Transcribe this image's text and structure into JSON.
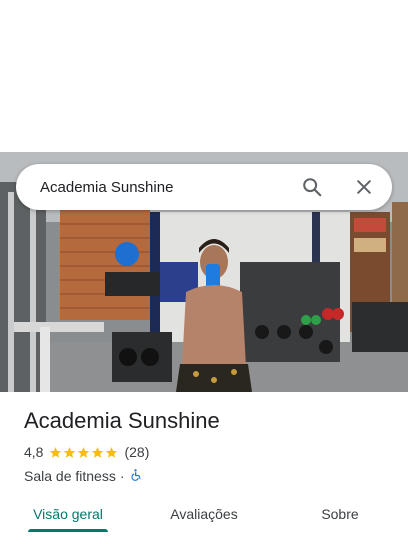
{
  "search": {
    "query": "Academia Sunshine"
  },
  "icons": {
    "search": "search-icon",
    "close": "close-icon",
    "star": "star-icon",
    "accessibility": "wheelchair-icon"
  },
  "colors": {
    "accent": "#00796b",
    "star": "#fbbc04",
    "accessibility": "#1a73e8"
  },
  "place": {
    "name": "Academia Sunshine",
    "rating": "4,8",
    "stars": 4.8,
    "review_count": "(28)",
    "category": "Sala de fitness",
    "separator": "·"
  },
  "tabs": [
    {
      "label": "Visão geral",
      "active": true
    },
    {
      "label": "Avaliações",
      "active": false
    },
    {
      "label": "Sobre",
      "active": false
    }
  ]
}
